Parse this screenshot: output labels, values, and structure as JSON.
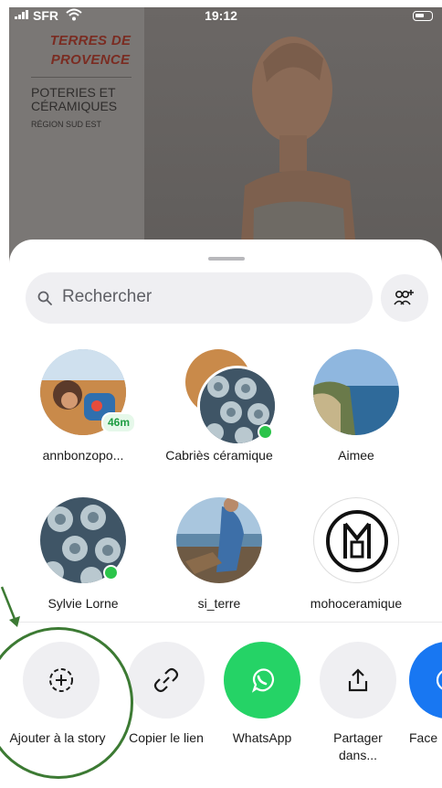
{
  "status_bar": {
    "carrier": "SFR",
    "time": "19:12"
  },
  "background_post": {
    "brand_line1": "TERRES DE",
    "brand_line2": "PROVENCE",
    "subtitle_line1": "POTERIES ET",
    "subtitle_line2": "CÉRAMIQUES",
    "region": "RÉGION SUD EST"
  },
  "search": {
    "placeholder": "Rechercher"
  },
  "contacts": [
    {
      "name": "annbonzopo...",
      "badge": "46m"
    },
    {
      "name": "Cabriès céramique",
      "online": true
    },
    {
      "name": "Aimee"
    },
    {
      "name": "Sylvie Lorne",
      "online": true
    },
    {
      "name": "si_terre"
    },
    {
      "name": "mohoceramique"
    }
  ],
  "actions": [
    {
      "label": "Ajouter à la story",
      "icon": "add-story-icon"
    },
    {
      "label": "Copier le lien",
      "icon": "link-icon"
    },
    {
      "label": "WhatsApp",
      "icon": "whatsapp-icon",
      "color": "#25d366"
    },
    {
      "label": "Partager dans...",
      "icon": "share-icon"
    },
    {
      "label": "Face",
      "icon": "facebook-icon",
      "color": "#1877f2"
    }
  ],
  "colors": {
    "annotation": "#3c7a33",
    "online": "#2bc44a"
  }
}
